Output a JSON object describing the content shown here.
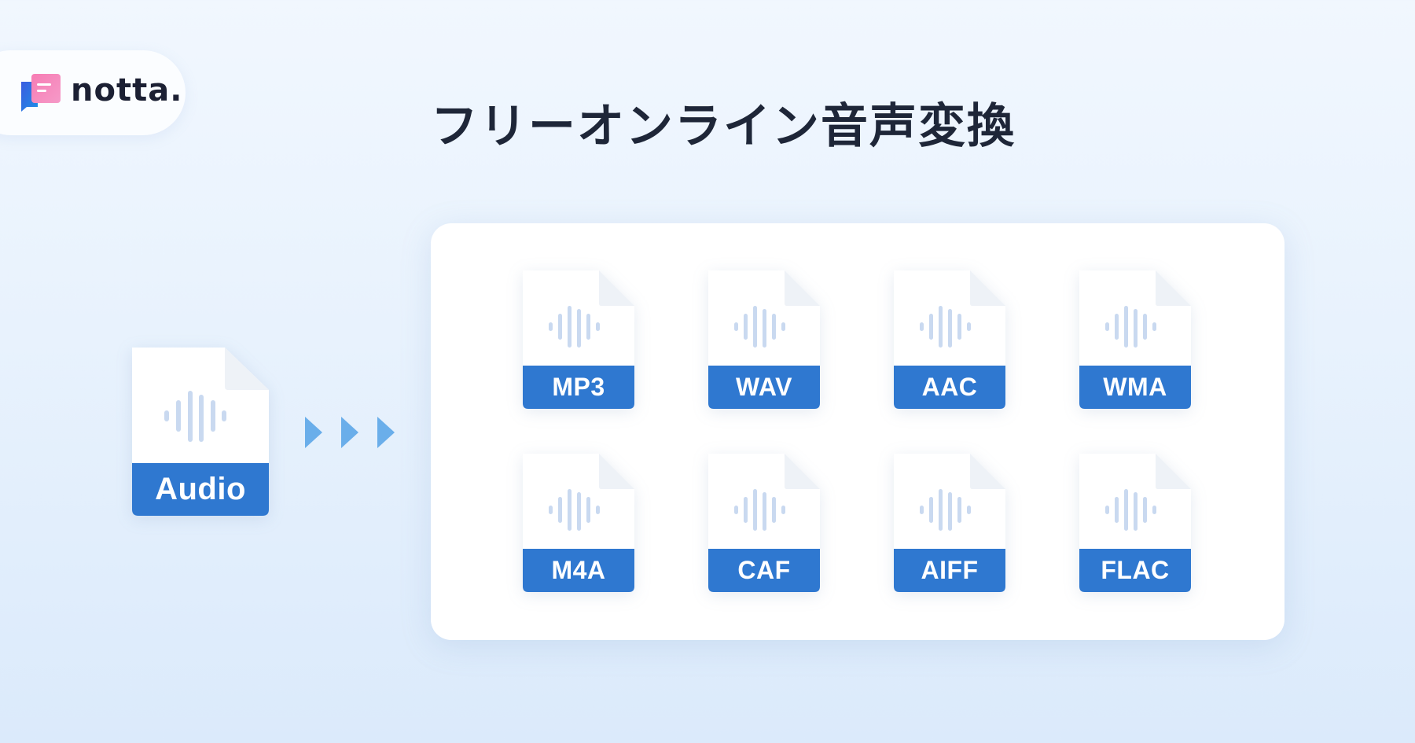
{
  "brand": {
    "name": "notta.",
    "logo_icon": "notta-folder-logo-icon"
  },
  "title": "フリーオンライン音声変換",
  "source_file": {
    "label": "Audio",
    "icon": "audio-waveform-icon"
  },
  "arrow_icons": [
    "play-arrow-icon",
    "play-arrow-icon",
    "play-arrow-icon"
  ],
  "formats": [
    {
      "label": "MP3"
    },
    {
      "label": "WAV"
    },
    {
      "label": "AAC"
    },
    {
      "label": "WMA"
    },
    {
      "label": "M4A"
    },
    {
      "label": "CAF"
    },
    {
      "label": "AIFF"
    },
    {
      "label": "FLAC"
    }
  ],
  "colors": {
    "accent_blue": "#2f78d0",
    "arrow_blue": "#6aaeea",
    "waveform": "#c9d9f0",
    "title_text": "#1e2638"
  }
}
